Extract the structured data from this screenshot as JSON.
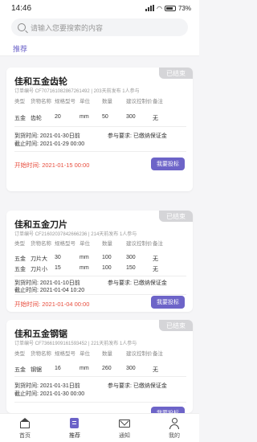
{
  "status_bar": {
    "time": "14:46",
    "battery": "73%"
  },
  "search": {
    "placeholder": "请输入您要搜索的内容"
  },
  "tabs": {
    "recommend": "推荐"
  },
  "table_headers": [
    "类型",
    "货物名称",
    "规格型号",
    "单位",
    "数量",
    "建议控制价",
    "备注"
  ],
  "labels": {
    "deadline_label": "到货时间:",
    "close_label": "截止时间:",
    "req_label": "参与要求:",
    "start_label": "开始时间:",
    "bid_button": "我要投标",
    "status_badge": "已结束"
  },
  "cards": [
    {
      "title": "佳和五金齿轮",
      "meta": "订单编号 CF707161082867261492 | 203天前发布 1人参与",
      "rows": [
        [
          "五金",
          "齿轮",
          "20",
          "mm",
          "50",
          "300",
          "无"
        ]
      ],
      "arrival": "2021-01-30日前",
      "close": "2021-01-29 00:00",
      "requirement": "已缴纳保证金",
      "start": "2021-01-15 00:00"
    },
    {
      "title": "佳和五金刀片",
      "meta": "订单编号 CF21602037842666236 | 214天前发布 1人参与",
      "rows": [
        [
          "五金",
          "刀片大",
          "30",
          "mm",
          "100",
          "300",
          "无"
        ],
        [
          "五金",
          "刀片小",
          "15",
          "mm",
          "100",
          "150",
          "无"
        ]
      ],
      "arrival": "2021-01-10日前",
      "close": "2021-01-04 10:20",
      "requirement": "已缴纳保证金",
      "start": "2021-01-04 00:00"
    },
    {
      "title": "佳和五金钢锯",
      "meta": "订单编号 CF73661909161593452 | 221天前发布 1人参与",
      "rows": [
        [
          "五金",
          "钢锯",
          "16",
          "mm",
          "260",
          "300",
          "无"
        ]
      ],
      "arrival": "2021-01-31日前",
      "close": "2021-01-30 00:00",
      "requirement": "已缴纳保证金"
    }
  ],
  "bottom_nav": [
    {
      "label": "首页",
      "icon": "home-icon"
    },
    {
      "label": "推荐",
      "icon": "recommend-icon"
    },
    {
      "label": "通知",
      "icon": "mail-icon"
    },
    {
      "label": "我的",
      "icon": "user-icon"
    }
  ],
  "colors": {
    "accent": "#6d64c8",
    "start_time": "#e74c3c",
    "badge": "#d5d5d8"
  }
}
